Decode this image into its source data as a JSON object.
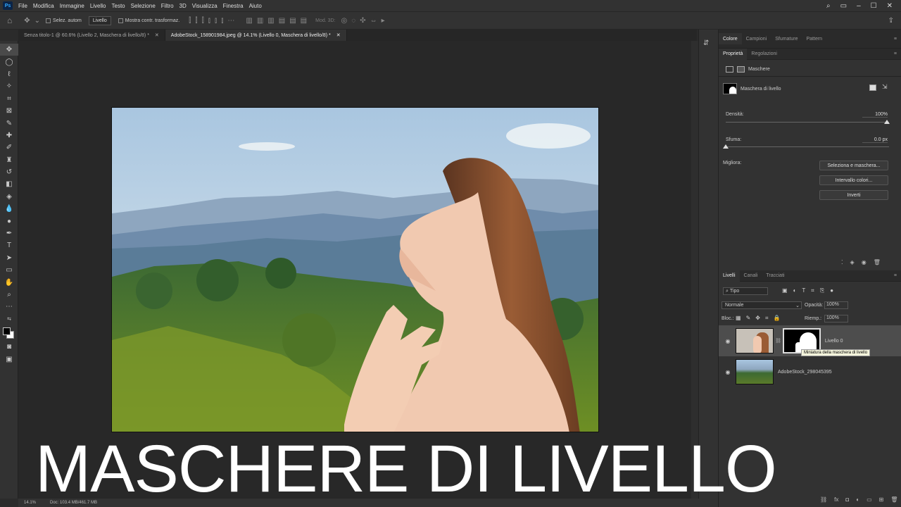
{
  "menubar": {
    "items": [
      "File",
      "Modifica",
      "Immagine",
      "Livello",
      "Testo",
      "Selezione",
      "Filtro",
      "3D",
      "Visualizza",
      "Finestra",
      "Aiuto"
    ],
    "app_icon": "Ps"
  },
  "options": {
    "auto_select_label": "Selez. autom",
    "auto_select_value": "Livello",
    "transform_label": "Mostra contr. trasformaz.",
    "mode3d": "Mod. 3D:"
  },
  "tabs": [
    {
      "label": "Senza titolo-1 @ 60.6% (Livello 2, Maschera di livello/8) *"
    },
    {
      "label": "AdobeStock_158901984.jpeg @ 14.1% (Livello 0, Maschera di livello/8) *"
    }
  ],
  "status": {
    "zoom": "14.1%",
    "doc": "Doc: 103.4 MB/461.7 MB"
  },
  "top_panel": {
    "tabs": [
      "Colore",
      "Campioni",
      "Sfumature",
      "Pattern"
    ]
  },
  "properties": {
    "tabs": [
      "Proprietà",
      "Regolazioni"
    ],
    "section": "Maschere",
    "mask_label": "Maschera di livello",
    "density_label": "Densità:",
    "density_value": "100%",
    "feather_label": "Sfuma:",
    "feather_value": "0.0 px",
    "refine_label": "Migliora:",
    "btn_select_mask": "Seleziona e maschera...",
    "btn_color_range": "Intervallo colori...",
    "btn_invert": "Inverti"
  },
  "layers": {
    "tabs": [
      "Livelli",
      "Canali",
      "Tracciati"
    ],
    "filter_kind": "Tipo",
    "blend_mode": "Normale",
    "opacity_label": "Opacità:",
    "opacity_value": "100%",
    "lock_label": "Bloc.:",
    "fill_label": "Riemp.:",
    "fill_value": "100%",
    "items": [
      {
        "name": "Livello 0"
      },
      {
        "name": "AdobeStock_298045395"
      }
    ],
    "tooltip": "Miniatura della maschera di livello"
  },
  "overlay_title": "MASCHERE DI LIVELLO"
}
